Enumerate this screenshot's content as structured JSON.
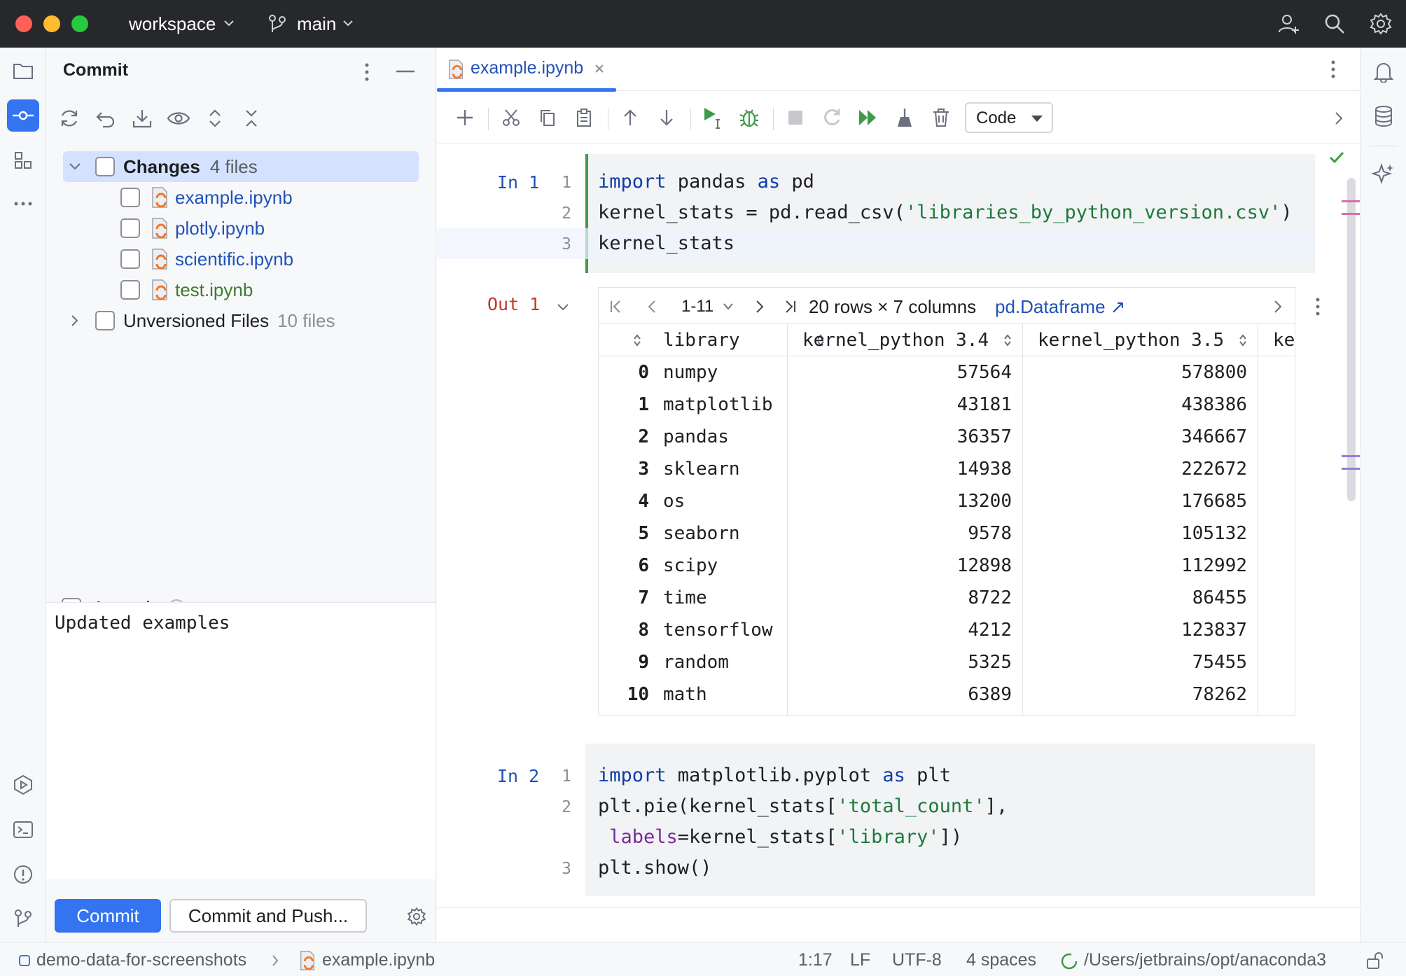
{
  "titlebar": {
    "project": "workspace",
    "branch": "main"
  },
  "commit_panel": {
    "title": "Commit",
    "changes_label": "Changes",
    "changes_count": "4 files",
    "files": [
      {
        "name": "example.ipynb",
        "status": "modified"
      },
      {
        "name": "plotly.ipynb",
        "status": "modified"
      },
      {
        "name": "scientific.ipynb",
        "status": "modified"
      },
      {
        "name": "test.ipynb",
        "status": "added"
      }
    ],
    "unversioned_label": "Unversioned Files",
    "unversioned_count": "10 files",
    "amend_label": "Amend",
    "message": "Updated examples",
    "commit_button": "Commit",
    "commit_push_button": "Commit and Push..."
  },
  "editor": {
    "tab_name": "example.ipynb",
    "cell_type": "Code",
    "cells": [
      {
        "prompt": "In 1",
        "lines": [
          {
            "num": "1"
          },
          {
            "num": "2"
          },
          {
            "num": "3"
          }
        ]
      },
      {
        "prompt": "In 2",
        "lines": [
          {
            "num": "1"
          },
          {
            "num": "2"
          },
          {
            "num": ""
          },
          {
            "num": "3"
          }
        ]
      }
    ],
    "code": {
      "c1l1_kw1": "import",
      "c1l1_mid": " pandas ",
      "c1l1_kw2": "as",
      "c1l1_end": " pd",
      "c1l2_a": "kernel_stats = pd.read_csv(",
      "c1l2_str": "'libraries_by_python_version.csv'",
      "c1l2_b": ")",
      "c1l3": "kernel_stats",
      "c2l1_kw1": "import",
      "c2l1_mid": " matplotlib.pyplot ",
      "c2l1_kw2": "as",
      "c2l1_end": " plt",
      "c2l2_a": "plt.pie(kernel_stats[",
      "c2l2_str": "'total_count'",
      "c2l2_b": "],",
      "c2l3_kwarg": " labels",
      "c2l3_a": "=kernel_stats[",
      "c2l3_str": "'library'",
      "c2l3_b": "])",
      "c2l4": "plt.show()"
    },
    "output": {
      "prompt": "Out 1",
      "range": "1-11",
      "summary": "20 rows × 7 columns",
      "link": "pd.Dataframe ↗",
      "columns": [
        "library",
        "kernel_python 3.4",
        "kernel_python 3.5",
        "ke"
      ],
      "rows": [
        [
          "0",
          "numpy",
          "57564",
          "578800"
        ],
        [
          "1",
          "matplotlib",
          "43181",
          "438386"
        ],
        [
          "2",
          "pandas",
          "36357",
          "346667"
        ],
        [
          "3",
          "sklearn",
          "14938",
          "222672"
        ],
        [
          "4",
          "os",
          "13200",
          "176685"
        ],
        [
          "5",
          "seaborn",
          "9578",
          "105132"
        ],
        [
          "6",
          "scipy",
          "12898",
          "112992"
        ],
        [
          "7",
          "time",
          "8722",
          "86455"
        ],
        [
          "8",
          "tensorflow",
          "4212",
          "123837"
        ],
        [
          "9",
          "random",
          "5325",
          "75455"
        ],
        [
          "10",
          "math",
          "6389",
          "78262"
        ]
      ]
    }
  },
  "statusbar": {
    "project": "demo-data-for-screenshots",
    "file": "example.ipynb",
    "position": "1:17",
    "line_ending": "LF",
    "encoding": "UTF-8",
    "indent": "4 spaces",
    "interpreter": "/Users/jetbrains/opt/anaconda3"
  },
  "colors": {
    "accent": "#3474f0",
    "titlebar": "#27282c",
    "keyword": "#0d3ea8",
    "string": "#1d7a3b",
    "output_prompt": "#c0392b"
  }
}
